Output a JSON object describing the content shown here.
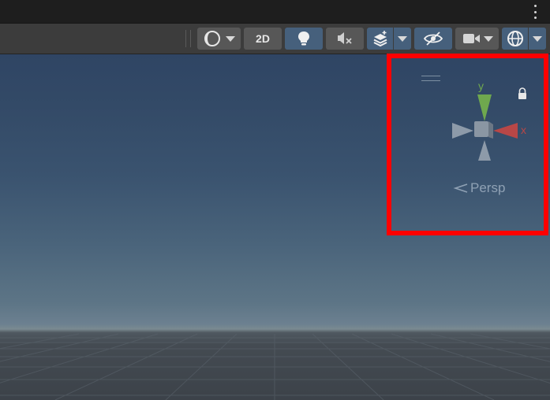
{
  "toolbar": {
    "shading_icon": "shading-mode-icon",
    "mode_2d_label": "2D",
    "lighting_icon": "light-bulb-icon",
    "audio_icon": "audio-mute-icon",
    "effects_icon": "effects-layers-icon",
    "visibility_icon": "hidden-eye-icon",
    "camera_icon": "camera-icon",
    "gizmos_icon": "gizmos-globe-icon"
  },
  "scene_gizmo": {
    "y_label": "y",
    "x_label": "x",
    "projection_label": "Persp",
    "lock_icon": "lock-icon",
    "colors": {
      "y_axis": "#6fa84e",
      "x_axis": "#b84747",
      "neutral": "#8d9aa9"
    }
  },
  "highlight_color": "#ff0000"
}
